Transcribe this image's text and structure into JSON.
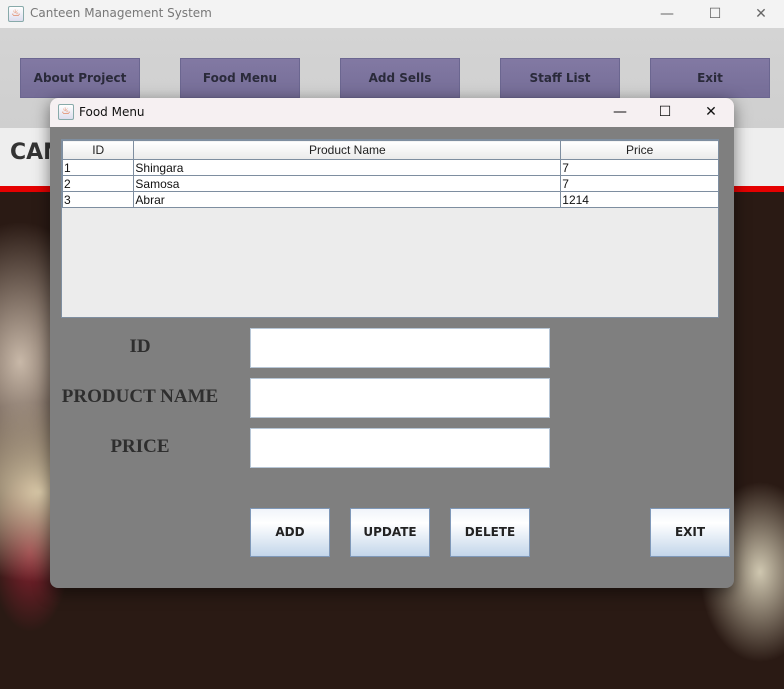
{
  "main_window": {
    "title": "Canteen Management System",
    "controls": {
      "minimize": "—",
      "maximize": "☐",
      "close": "✕"
    },
    "menu_buttons": [
      "About Project",
      "Food Menu",
      "Add Sells",
      "Staff List",
      "Exit"
    ],
    "banner_text": "CAN"
  },
  "dialog": {
    "title": "Food Menu",
    "controls": {
      "minimize": "—",
      "maximize": "☐",
      "close": "✕"
    },
    "table": {
      "columns": [
        "ID",
        "Product Name",
        "Price"
      ],
      "rows": [
        [
          "1",
          "Shingara",
          "7"
        ],
        [
          "2",
          "Samosa",
          "7"
        ],
        [
          "3",
          "Abrar",
          "1214"
        ]
      ]
    },
    "form": {
      "id_label": "ID",
      "name_label": "PRODUCT NAME",
      "price_label": "PRICE",
      "id_value": "",
      "name_value": "",
      "price_value": ""
    },
    "buttons": {
      "add": "ADD",
      "update": "UPDATE",
      "delete": "DELETE",
      "exit": "EXIT"
    }
  }
}
